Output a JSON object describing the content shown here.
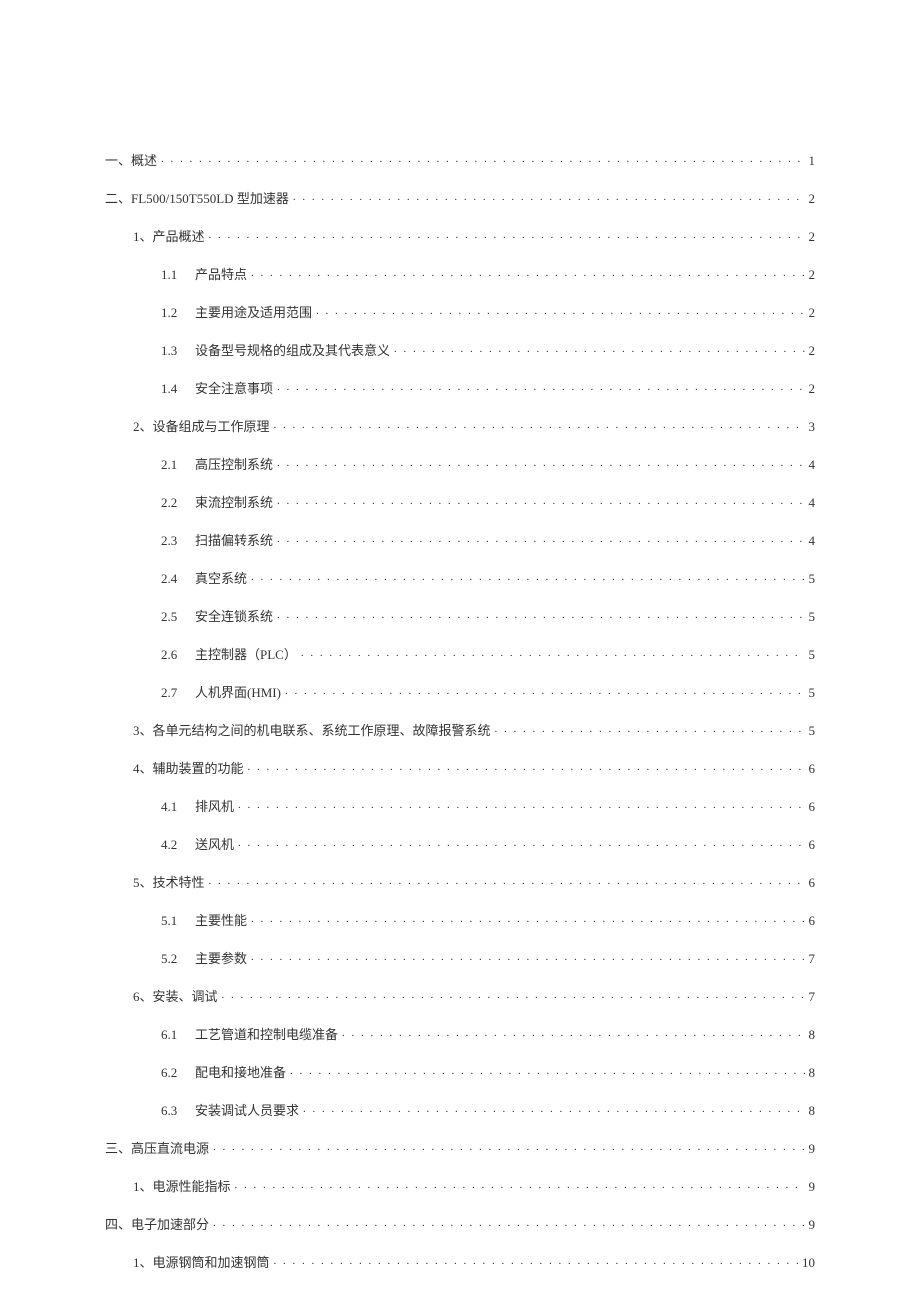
{
  "toc": [
    {
      "level": 0,
      "num": "一、",
      "title": "概述",
      "page": "1"
    },
    {
      "level": 0,
      "num": "二、",
      "title": "FL500/150T550LD 型加速器",
      "page": "2"
    },
    {
      "level": 1,
      "num": "1、",
      "title": "产品概述",
      "page": "2"
    },
    {
      "level": 2,
      "num": "1.1",
      "title": "产品特点",
      "page": "2"
    },
    {
      "level": 2,
      "num": "1.2",
      "title": "主要用途及适用范围",
      "page": "2"
    },
    {
      "level": 2,
      "num": "1.3",
      "title": "设备型号规格的组成及其代表意义",
      "page": "2"
    },
    {
      "level": 2,
      "num": "1.4",
      "title": "安全注意事项",
      "page": "2"
    },
    {
      "level": 1,
      "num": "2、",
      "title": "设备组成与工作原理",
      "page": "3"
    },
    {
      "level": 2,
      "num": "2.1",
      "title": "高压控制系统",
      "page": "4"
    },
    {
      "level": 2,
      "num": "2.2",
      "title": "束流控制系统",
      "page": "4"
    },
    {
      "level": 2,
      "num": "2.3",
      "title": "扫描偏转系统",
      "page": "4"
    },
    {
      "level": 2,
      "num": "2.4",
      "title": "真空系统",
      "page": "5"
    },
    {
      "level": 2,
      "num": "2.5",
      "title": "安全连锁系统",
      "page": "5"
    },
    {
      "level": 2,
      "num": "2.6",
      "title": "主控制器（PLC）",
      "page": "5"
    },
    {
      "level": 2,
      "num": "2.7",
      "title": "人机界面(HMI)",
      "page": "5"
    },
    {
      "level": 1,
      "num": "3、",
      "title": "各单元结构之间的机电联系、系统工作原理、故障报警系统",
      "page": "5"
    },
    {
      "level": 1,
      "num": "4、",
      "title": "辅助装置的功能",
      "page": "6"
    },
    {
      "level": 2,
      "num": "4.1",
      "title": "排风机",
      "page": "6"
    },
    {
      "level": 2,
      "num": "4.2",
      "title": "送风机",
      "page": "6"
    },
    {
      "level": 1,
      "num": "5、",
      "title": "技术特性",
      "page": "6"
    },
    {
      "level": 2,
      "num": "5.1",
      "title": "主要性能",
      "page": "6"
    },
    {
      "level": 2,
      "num": "5.2",
      "title": "主要参数",
      "page": "7"
    },
    {
      "level": 1,
      "num": "6、",
      "title": "安装、调试",
      "page": "7"
    },
    {
      "level": 2,
      "num": "6.1",
      "title": "工艺管道和控制电缆准备",
      "page": "8"
    },
    {
      "level": 2,
      "num": "6.2",
      "title": "配电和接地准备",
      "page": "8"
    },
    {
      "level": 2,
      "num": "6.3",
      "title": "安装调试人员要求",
      "page": "8"
    },
    {
      "level": 0,
      "num": "三、",
      "title": "高压直流电源",
      "page": "9"
    },
    {
      "level": 1,
      "num": "1、",
      "title": "电源性能指标",
      "page": "9"
    },
    {
      "level": 0,
      "num": "四、",
      "title": "电子加速部分",
      "page": "9"
    },
    {
      "level": 1,
      "num": "1、",
      "title": "电源钢筒和加速钢筒",
      "page": "10"
    }
  ]
}
